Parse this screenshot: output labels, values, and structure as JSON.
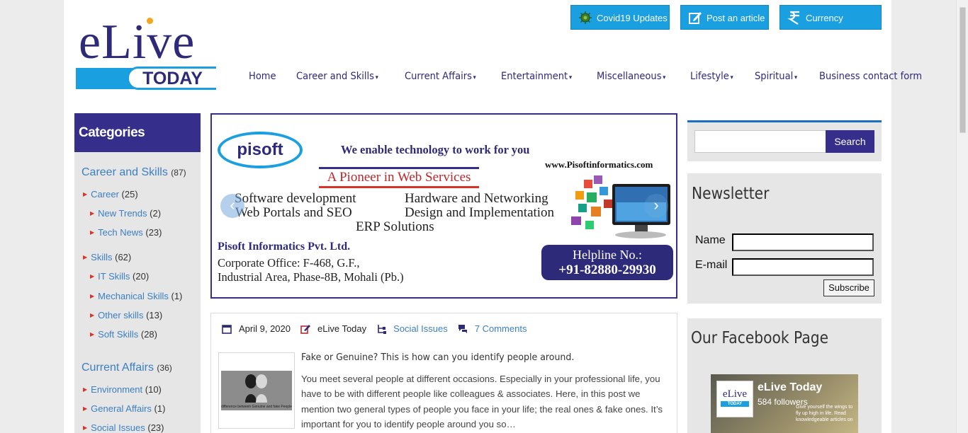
{
  "logo": {
    "word": "eLive",
    "badge": "TODAY"
  },
  "top_buttons": [
    {
      "label": "Covid19 Updates",
      "icon": "virus-icon"
    },
    {
      "label": "Post an article",
      "icon": "edit-icon"
    },
    {
      "label": "Currency Convertor",
      "icon": "rupee-icon"
    }
  ],
  "nav": [
    {
      "label": "Home",
      "dropdown": false
    },
    {
      "label": "Career and Skills",
      "dropdown": true
    },
    {
      "label": "Current Affairs",
      "dropdown": true
    },
    {
      "label": "Entertainment",
      "dropdown": true
    },
    {
      "label": "Miscellaneous",
      "dropdown": true
    },
    {
      "label": "Lifestyle",
      "dropdown": true
    },
    {
      "label": "Spiritual",
      "dropdown": true
    },
    {
      "label": "Business contact form",
      "dropdown": false
    }
  ],
  "sidebar": {
    "title": "Categories",
    "items": [
      {
        "label": "Career and Skills",
        "count": "(87)",
        "level": 0
      },
      {
        "label": "Career",
        "count": "(25)",
        "level": 1
      },
      {
        "label": "New Trends",
        "count": "(2)",
        "level": 2
      },
      {
        "label": "Tech News",
        "count": "(23)",
        "level": 2
      },
      {
        "label": "Skills",
        "count": "(62)",
        "level": 1
      },
      {
        "label": "IT Skills",
        "count": "(20)",
        "level": 2
      },
      {
        "label": "Mechanical Skills",
        "count": "(1)",
        "level": 2
      },
      {
        "label": "Other skills",
        "count": "(13)",
        "level": 2
      },
      {
        "label": "Soft Skills",
        "count": "(28)",
        "level": 2
      },
      {
        "label": "Current Affairs",
        "count": "(36)",
        "level": 0
      },
      {
        "label": "Environment",
        "count": "(10)",
        "level": 1
      },
      {
        "label": "General Affairs",
        "count": "(1)",
        "level": 1
      },
      {
        "label": "Social Issues",
        "count": "(23)",
        "level": 1
      }
    ]
  },
  "slider": {
    "logo": "pisoft",
    "tagline": "We enable technology to work for you",
    "pioneer": "A Pioneer in Web Services",
    "url": "www.Pisoftinformatics.com",
    "services": [
      "Software development",
      "Web Portals and SEO",
      "Hardware and Networking",
      "Design and Implementation",
      "ERP Solutions"
    ],
    "company": "Pisoft Informatics Pvt. Ltd.",
    "address": [
      "Corporate Office: F-468, G.F.,",
      "Industrial Area, Phase-8B, Mohali (Pb.)"
    ],
    "helpline_label": "Helpline No.:",
    "helpline_number": "+91-82880-29930"
  },
  "post": {
    "date": "April 9, 2020",
    "author": "eLive Today",
    "category": "Social Issues",
    "comments": "7 Comments",
    "title": "Fake or Genuine? This is how can you identify people around.",
    "excerpt": "You meet several people at different occasions. Especially in your professional life, you have to be with different people like colleagues & associates. Here, in this post we mention two general types of people you face in your life; the real ones & fake ones. It’s important for you to identify people around you so…",
    "thumb_caption": "difference between Genuine and fake People"
  },
  "search": {
    "button": "Search",
    "value": ""
  },
  "newsletter": {
    "title": "Newsletter",
    "name_label": "Name",
    "email_label": "E-mail",
    "subscribe": "Subscribe"
  },
  "facebook": {
    "title": "Our Facebook Page",
    "page_name": "eLive Today",
    "followers": "584 followers",
    "slogan": "Give yourself the wings to fly up high in life. Read knowledgeable articles on"
  },
  "colors": {
    "brand_blue": "#1a9fe0",
    "brand_navy": "#352e8a",
    "link": "#3b7fc4",
    "bullet_red": "#d9342b"
  }
}
